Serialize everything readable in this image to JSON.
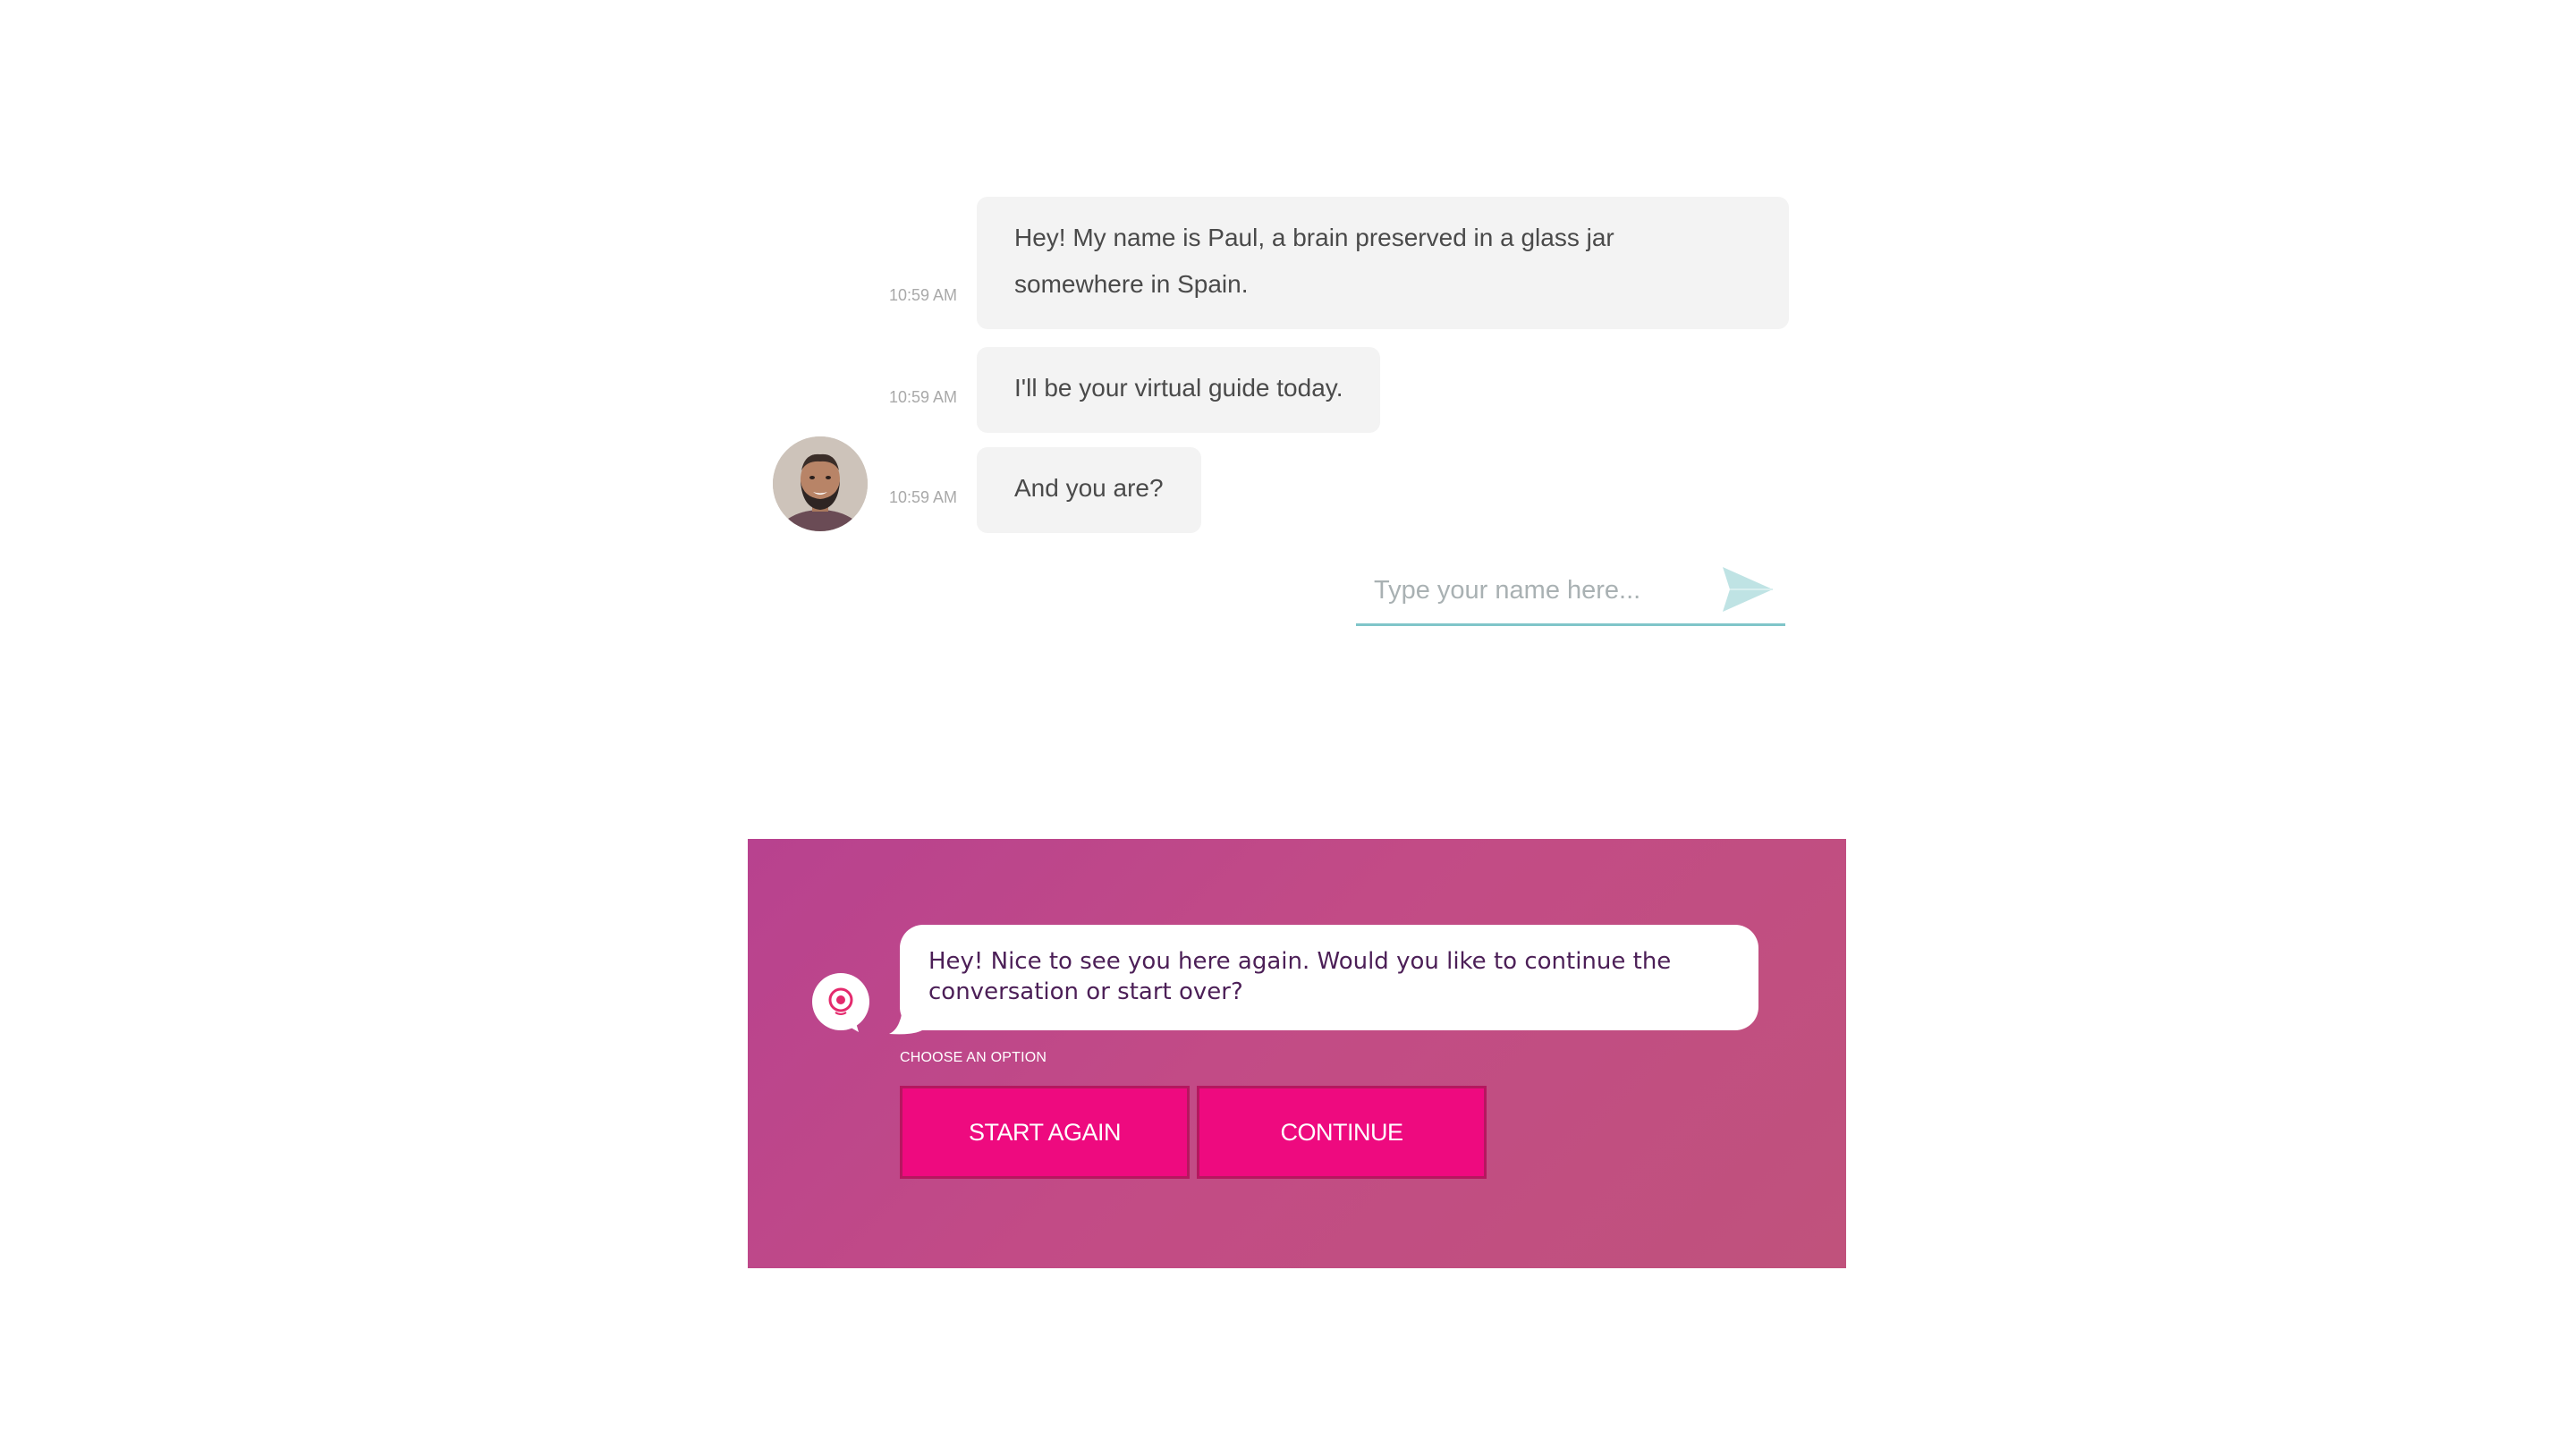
{
  "chat": {
    "messages": [
      {
        "text_line1": "Hey! My name is Paul, a brain preserved in a glass jar",
        "text_line2": "somewhere in Spain.",
        "time": "10:59 AM"
      },
      {
        "text": "I'll be your virtual guide today.",
        "time": "10:59 AM"
      },
      {
        "text": "And you are?",
        "time": "10:59 AM"
      }
    ],
    "input": {
      "placeholder": "Type your name here..."
    },
    "send_icon": "send-arrow-icon",
    "avatar_icon": "paul-avatar"
  },
  "panel": {
    "message_line1": "Hey! Nice to see you here again. Would you like to continue the",
    "message_line2": "conversation or start over?",
    "choose_label": "CHOOSE AN OPTION",
    "options": [
      {
        "label": "START AGAIN"
      },
      {
        "label": "CONTINUE"
      }
    ],
    "bot_icon": "chat-bot-icon"
  },
  "colors": {
    "bubble_bg": "#f3f3f3",
    "input_underline": "#7fc5c9",
    "send_icon": "#bfe3e4",
    "panel_bg": "#c24b86",
    "button_bg": "#ee0a7f",
    "panel_text": "#4c1f57"
  }
}
